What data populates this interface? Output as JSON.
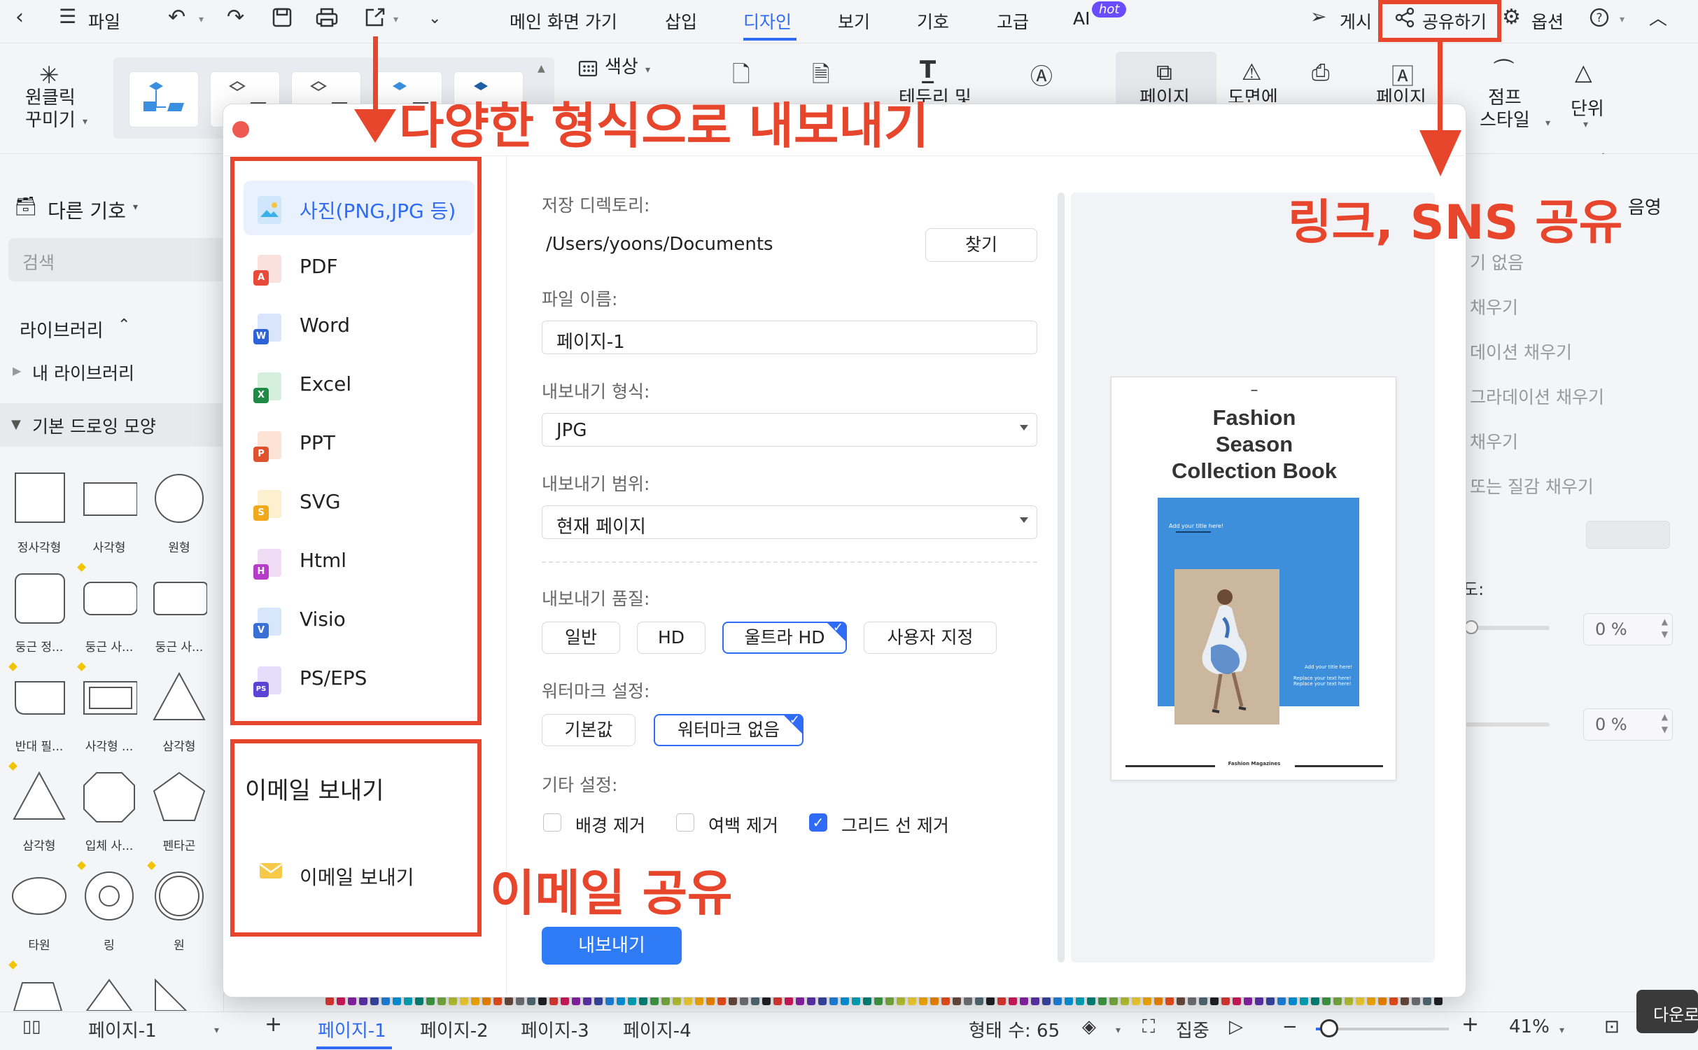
{
  "menubar": {
    "file": "파일",
    "tabs": [
      "메인 화면 가기",
      "삽입",
      "디자인",
      "보기",
      "기호",
      "고급",
      "AI"
    ],
    "ai_badge": "hot",
    "publish": "게시",
    "share": "공유하기",
    "options": "옵션"
  },
  "ribbon": {
    "oneclick_line1": "원클릭",
    "oneclick_line2": "꾸미기",
    "color": "색상",
    "btn_page": "페이지",
    "btn_drawing": "도면에",
    "btn_page2": "페이지",
    "jump_style_line1": "점프",
    "jump_style_line2": "스타일",
    "unit": "단위",
    "partial_border": "테두리 및"
  },
  "left_panel": {
    "more_symbols": "다른 기호",
    "search_placeholder": "검색",
    "library": "라이브러리",
    "my_library": "내 라이브러리",
    "basic_shapes": "기본 드로잉 모양",
    "shapes": [
      "정사각형",
      "사각형",
      "원형",
      "둥근 정...",
      "둥근 사...",
      "둥근 사...",
      "반대 필...",
      "사각형 ...",
      "삼각형",
      "삼각형",
      "입체 사...",
      "펜타곤",
      "타원",
      "링",
      "원"
    ]
  },
  "right_panel": {
    "tab": "음영",
    "fill_options": [
      "기 없음",
      "채우기",
      "데이션 채우기",
      "그라데이션 채우기",
      "채우기",
      "또는 질감 채우기"
    ],
    "partial_label": "도:",
    "percent1": "0 %",
    "percent2": "0 %"
  },
  "dialog": {
    "formats": [
      "사진(PNG,JPG 등)",
      "PDF",
      "Word",
      "Excel",
      "PPT",
      "SVG",
      "Html",
      "Visio",
      "PS/EPS"
    ],
    "email_section_title": "이메일 보내기",
    "email_item": "이메일 보내기",
    "save_dir_label": "저장 디렉토리:",
    "save_dir_value": "/Users/yoons/Documents",
    "browse_button": "찾기",
    "filename_label": "파일 이름:",
    "filename_value": "페이지-1",
    "format_label": "내보내기 형식:",
    "format_value": "JPG",
    "range_label": "내보내기 범위:",
    "range_value": "현재 페이지",
    "quality_label": "내보내기 품질:",
    "quality_options": [
      "일반",
      "HD",
      "울트라 HD",
      "사용자 지정"
    ],
    "quality_selected": "울트라 HD",
    "watermark_label": "워터마크 설정:",
    "watermark_options": [
      "기본값",
      "워터마크 없음"
    ],
    "watermark_selected": "워터마크 없음",
    "other_label": "기타 설정:",
    "checkboxes": [
      {
        "label": "배경 제거",
        "checked": false
      },
      {
        "label": "여백 제거",
        "checked": false
      },
      {
        "label": "그리드 선 제거",
        "checked": true
      }
    ],
    "export_button": "내보내기"
  },
  "preview": {
    "dash": "–",
    "title_line1": "Fashion",
    "title_line2": "Season",
    "title_line3": "Collection Book",
    "small_title": "Add your title here!",
    "small_text1": "Add your title here!",
    "small_text2": "Replace your text here!",
    "small_text3": "Replace your text here!",
    "footer": "Fashion Magazines",
    "accent_color": "#3d8fdb"
  },
  "annotations": {
    "export_formats": "다양한 형식으로 내보내기",
    "link_sns": "링크, SNS 공유",
    "email_share": "이메일 공유",
    "color": "#e8452d"
  },
  "bottombar": {
    "page_selector": "페이지-1",
    "pages": [
      "페이지-1",
      "페이지-2",
      "페이지-3",
      "페이지-4"
    ],
    "shape_count": "형태 수: 65",
    "focus": "집중",
    "zoom": "41%",
    "download_tooltip": "다운로"
  },
  "colors": {
    "accent": "#2f6bf5",
    "annotation_red": "#e8452d"
  }
}
